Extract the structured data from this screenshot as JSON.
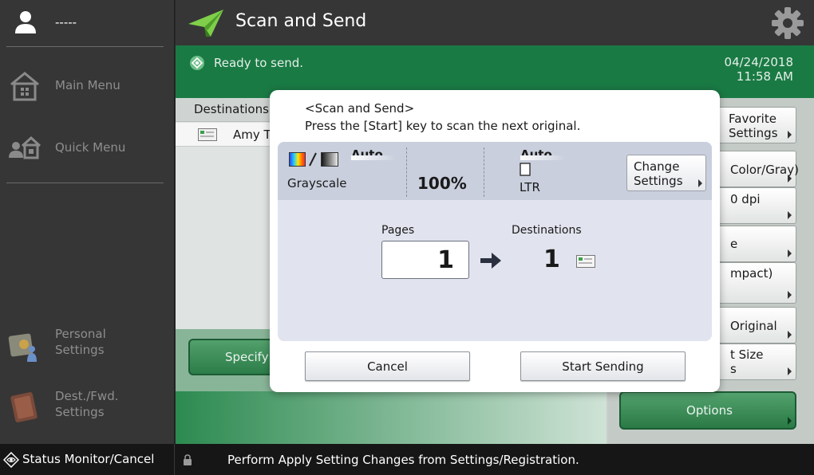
{
  "sidebar": {
    "user_name": "-----",
    "items": [
      {
        "label": "Main Menu",
        "icon": "home-icon"
      },
      {
        "label": "Quick Menu",
        "icon": "quick-menu-icon"
      },
      {
        "label_line1": "Personal",
        "label_line2": "Settings",
        "icon": "personal-settings-icon"
      },
      {
        "label_line1": "Dest./Fwd.",
        "label_line2": "Settings",
        "icon": "address-book-icon"
      }
    ]
  },
  "header": {
    "title": "Scan and Send",
    "icon": "paper-plane-icon",
    "settings_icon": "gear-icon"
  },
  "status": {
    "message": "Ready to send.",
    "date": "04/24/2018",
    "time": "11:58 AM"
  },
  "main": {
    "destinations_header": "Destinations",
    "destination_row": "Amy Ta",
    "specify_label": "Specify D",
    "right_buttons": [
      {
        "line1": "Favorite",
        "line2": "Settings"
      },
      {
        "line1": "Color/Gray)",
        "line2": ""
      },
      {
        "line1": "0 dpi",
        "line2": ""
      },
      {
        "line1": "e",
        "line2": ""
      },
      {
        "line1": "mpact)",
        "line2": ""
      },
      {
        "line1": "Original",
        "line2": ""
      },
      {
        "line1": "t Size",
        "line2": "s"
      }
    ],
    "options_label": "Options"
  },
  "modal": {
    "title": "<Scan and Send>",
    "subtitle": "Press the [Start] key to scan the next original.",
    "color_auto": "Auto",
    "color_mode": "Grayscale",
    "zoom": "100%",
    "size_auto": "Auto",
    "paper_size": "LTR",
    "change_settings_line1": "Change",
    "change_settings_line2": "Settings",
    "pages_label": "Pages",
    "pages_value": "1",
    "destinations_label": "Destinations",
    "destinations_value": "1",
    "cancel_label": "Cancel",
    "start_label": "Start Sending"
  },
  "bottombar": {
    "status_monitor": "Status Monitor/Cancel",
    "message": "Perform Apply Setting Changes from Settings/Registration."
  },
  "colors": {
    "status_green": "#1a7a44",
    "sidebar_bg": "#363636",
    "modal_panel": "#e1e4ee"
  }
}
